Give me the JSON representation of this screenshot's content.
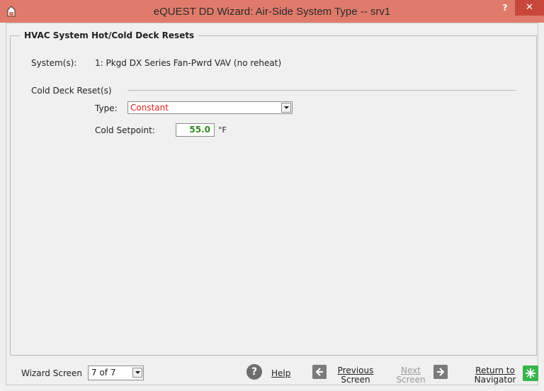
{
  "window": {
    "title": "eQUEST DD Wizard:  Air-Side System Type  --  srv1",
    "help_glyph": "?",
    "close_glyph": "✕"
  },
  "group": {
    "title": "HVAC System Hot/Cold Deck Resets"
  },
  "systems": {
    "label": "System(s):",
    "value": "1: Pkgd DX Series Fan-Pwrd VAV (no reheat)"
  },
  "cold_deck": {
    "section_title": "Cold Deck Reset(s)",
    "type_label": "Type:",
    "type_value": "Constant",
    "setpoint_label": "Cold Setpoint:",
    "setpoint_value": "55.0",
    "setpoint_unit": "°F"
  },
  "footer": {
    "wizard_label": "Wizard Screen",
    "wizard_value": "7 of 7",
    "help_label": "Help",
    "previous_line1": "Previous",
    "previous_line2": "Screen",
    "next_line1": "Next",
    "next_line2": "Screen",
    "return_line1": "Return to",
    "return_line2": "Navigator"
  },
  "colors": {
    "title_bar": "#e07b6c",
    "close_button": "#c7473b",
    "type_value": "#d8201c",
    "setpoint_value": "#2e8b20",
    "navigator_icon": "#37b44a"
  },
  "icons": {
    "app": "edit-shape-icon",
    "help": "question-circle-icon",
    "previous": "arrow-left-icon",
    "next": "arrow-right-icon",
    "navigator": "navigator-sparkle-icon",
    "dropdown": "chevron-down-icon"
  }
}
